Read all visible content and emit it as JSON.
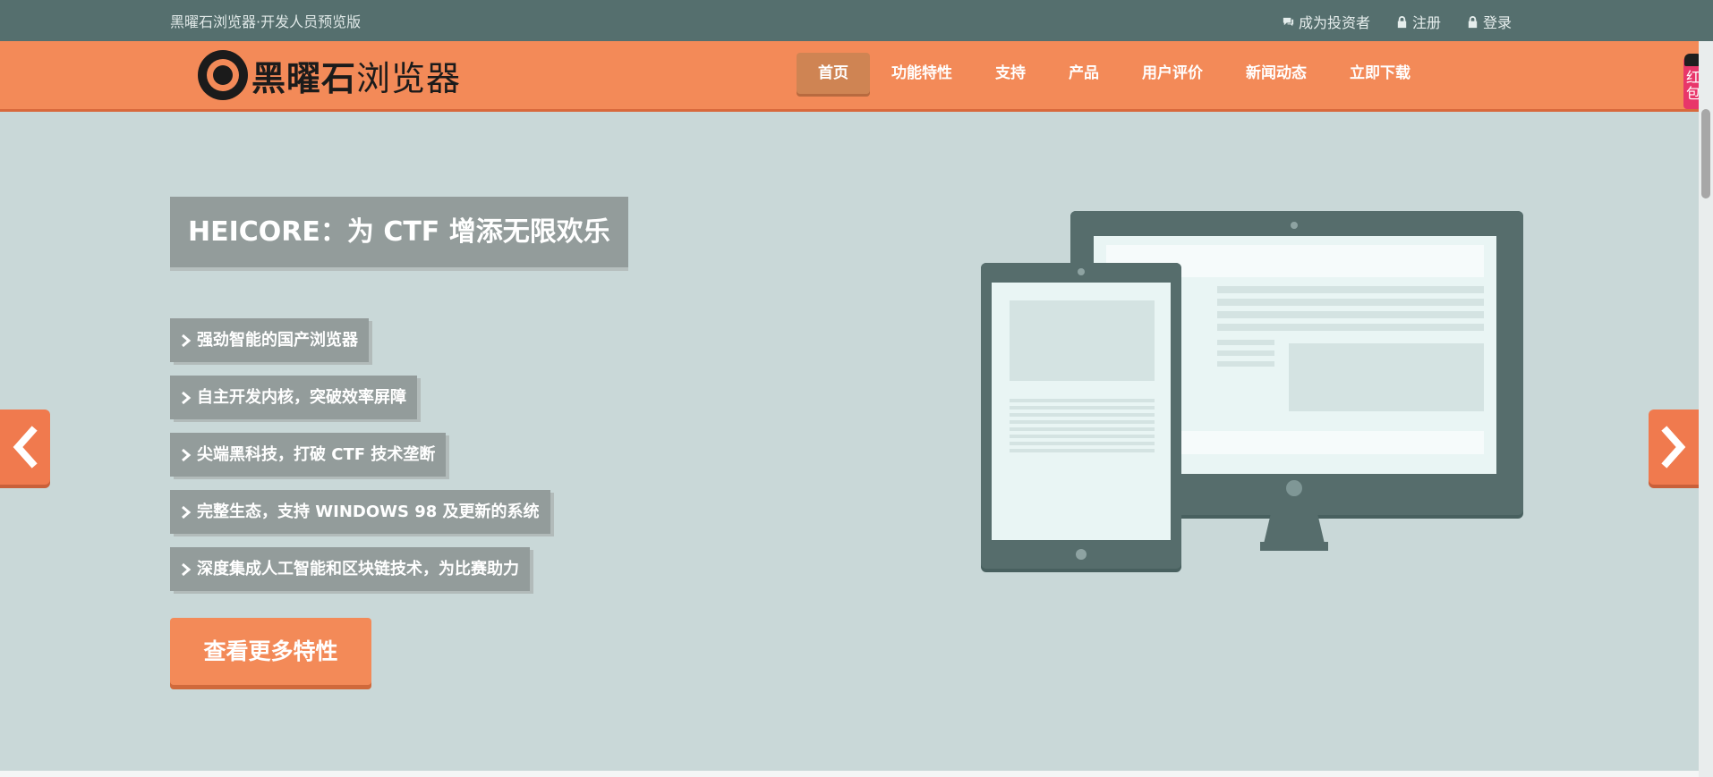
{
  "topbar": {
    "tagline": "黑曜石浏览器·开发人员预览版",
    "links": [
      {
        "label": "成为投资者",
        "icon": "chat-icon"
      },
      {
        "label": "注册",
        "icon": "lock-icon"
      },
      {
        "label": "登录",
        "icon": "lock-icon"
      }
    ]
  },
  "navbar": {
    "logo": {
      "bold": "黑曜石",
      "light": "浏览器"
    },
    "items": [
      {
        "label": "首页",
        "active": true
      },
      {
        "label": "功能特性"
      },
      {
        "label": "支持"
      },
      {
        "label": "产品"
      },
      {
        "label": "用户评价"
      },
      {
        "label": "新闻动态"
      },
      {
        "label": "立即下载"
      }
    ]
  },
  "side_badge": {
    "text": "红包"
  },
  "hero": {
    "title": "HEICORE：为 CTF 增添无限欢乐",
    "features": [
      "强劲智能的国产浏览器",
      "自主开发内核，突破效率屏障",
      "尖端黑科技，打破 CTF 技术垄断",
      "完整生态，支持 WINDOWS 98 及更新的系统",
      "深度集成人工智能和区块链技术，为比赛助力"
    ],
    "cta": "查看更多特性"
  },
  "colors": {
    "topbar": "#556f6e",
    "accent": "#f38a58",
    "hero_bg": "#c9d8d8",
    "panel": "#939c9b",
    "device_frame": "#566d6c"
  }
}
